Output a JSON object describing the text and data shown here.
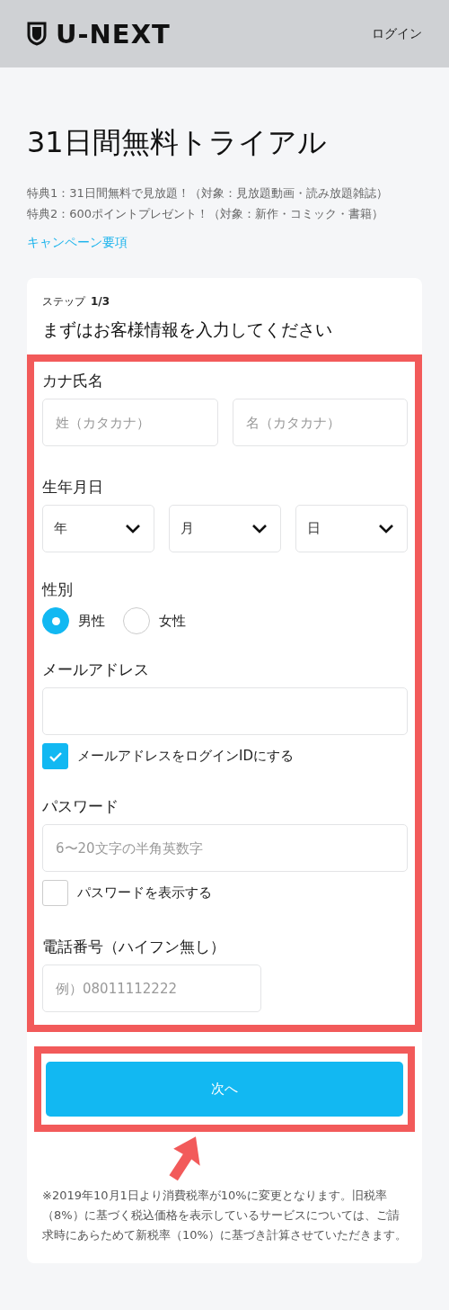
{
  "header": {
    "logo": "U-NEXT",
    "login": "ログイン"
  },
  "title": "31日間無料トライアル",
  "benefits": [
    "特典1：31日間無料で見放題！（対象：見放題動画・読み放題雑誌）",
    "特典2：600ポイントプレゼント！（対象：新作・コミック・書籍）"
  ],
  "campaign_link": "キャンペーン要項",
  "form": {
    "step_label": "ステップ",
    "step": "1/3",
    "heading": "まずはお客様情報を入力してください",
    "name": {
      "label": "カナ氏名",
      "fields": [
        {
          "placeholder": "姓（カタカナ）"
        },
        {
          "placeholder": "名（カタカナ）"
        }
      ]
    },
    "birthday": {
      "label": "生年月日",
      "selects": [
        {
          "value": "年"
        },
        {
          "value": "月"
        },
        {
          "value": "日"
        }
      ]
    },
    "gender": {
      "label": "性別",
      "options": [
        {
          "label": "男性",
          "selected": true
        },
        {
          "label": "女性",
          "selected": false
        }
      ]
    },
    "email": {
      "label": "メールアドレス",
      "checkbox": {
        "label": "メールアドレスをログインIDにする",
        "checked": true
      }
    },
    "password": {
      "label": "パスワード",
      "placeholder": "6〜20文字の半角英数字",
      "checkbox": {
        "label": "パスワードを表示する",
        "checked": false
      }
    },
    "phone": {
      "label": "電話番号（ハイフン無し）",
      "placeholder": "例）08011112222"
    },
    "next_button": "次へ"
  },
  "note": "※2019年10月1日より消費税率が10%に変更となります。旧税率（8%）に基づく税込価格を表示しているサービスについては、ご請求時にあらためて新税率（10%）に基づき計算させていただきます。"
}
